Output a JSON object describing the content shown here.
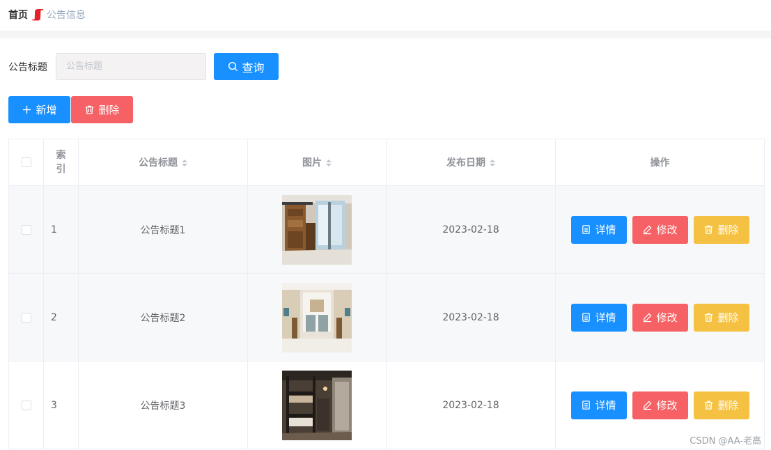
{
  "breadcrumb": {
    "home": "首页",
    "separator": "ʃʃʃ",
    "current": "公告信息"
  },
  "search": {
    "label": "公告标题",
    "placeholder": "公告标题",
    "value": "",
    "query_label": "查询"
  },
  "toolbar": {
    "add_label": "新增",
    "delete_label": "删除"
  },
  "table": {
    "headers": {
      "index": "索\n引",
      "title": "公告标题",
      "image": "图片",
      "date": "发布日期",
      "actions": "操作"
    },
    "rows": [
      {
        "index": "1",
        "title": "公告标题1",
        "date": "2023-02-18",
        "image_icon": "dorm-room-photo"
      },
      {
        "index": "2",
        "title": "公告标题2",
        "date": "2023-02-18",
        "image_icon": "dorm-room-photo"
      },
      {
        "index": "3",
        "title": "公告标题3",
        "date": "2023-02-18",
        "image_icon": "dorm-room-photo"
      }
    ],
    "row_actions": {
      "detail": "详情",
      "edit": "修改",
      "delete": "删除"
    }
  },
  "watermark": "CSDN @AA-老高",
  "colors": {
    "primary": "#1890ff",
    "danger": "#f56165",
    "warning": "#f5c142",
    "breadcrumb_sep": "#e6212a"
  }
}
